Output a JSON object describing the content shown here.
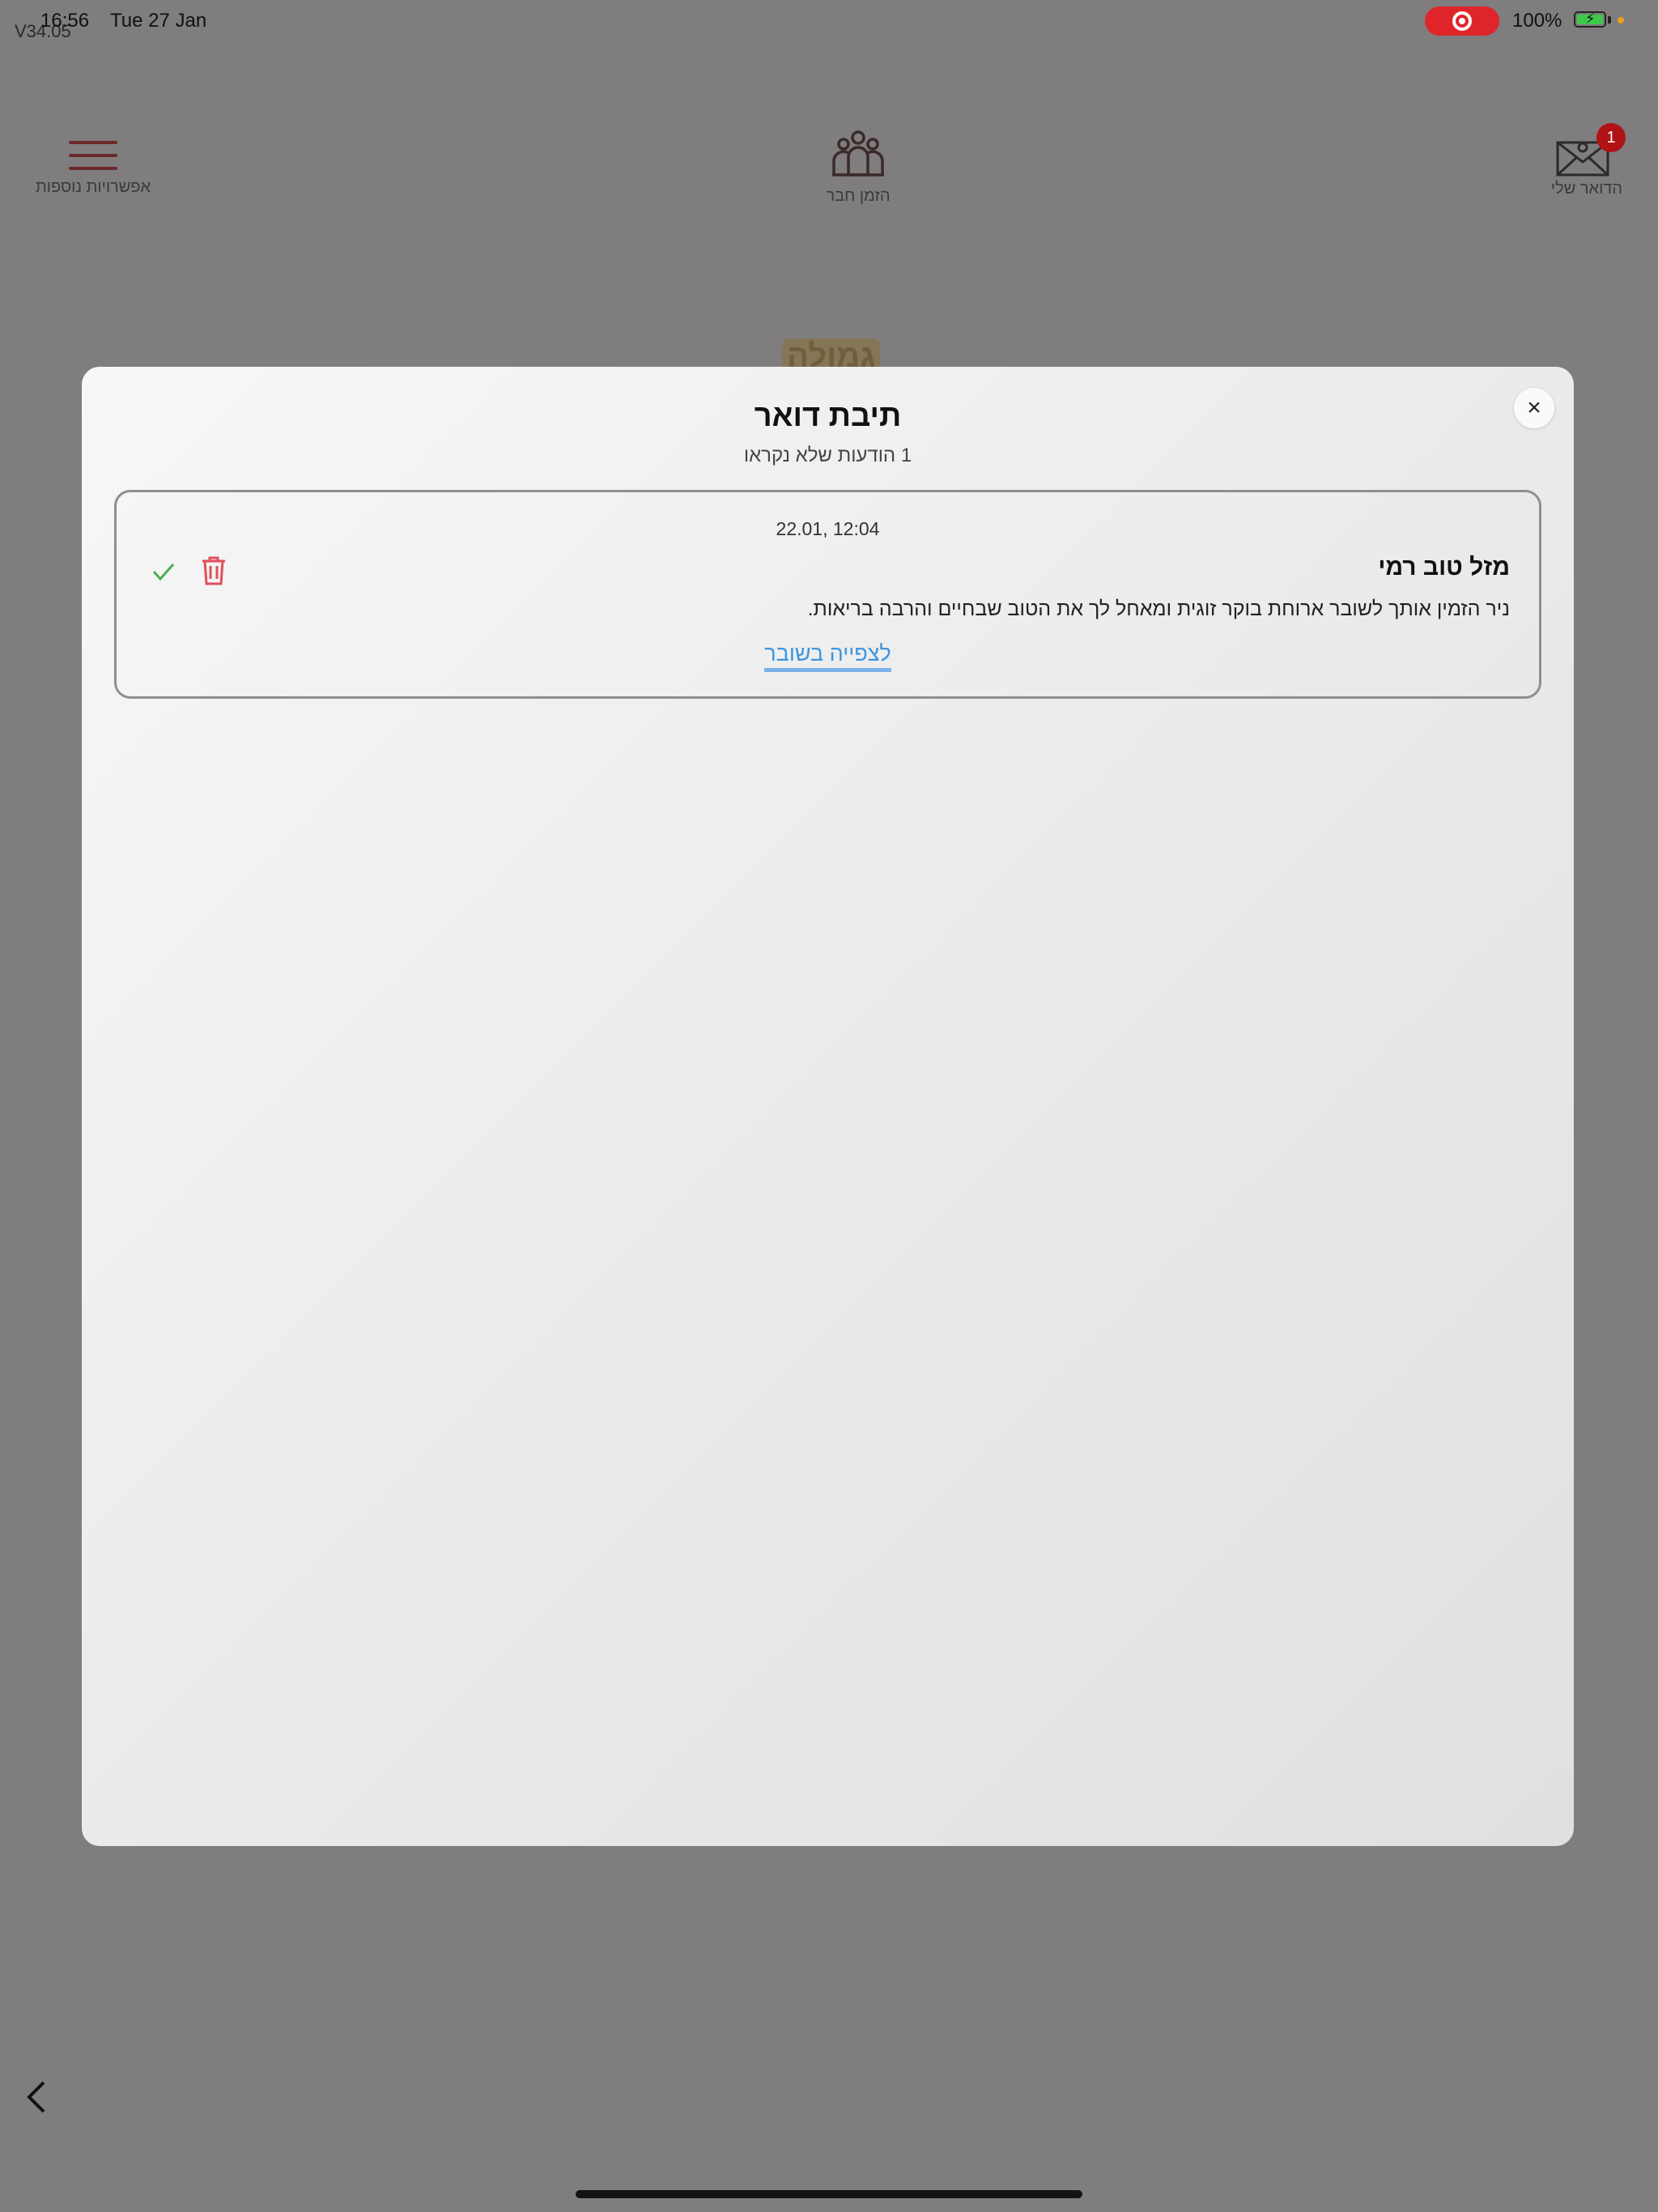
{
  "status_bar": {
    "version": "V34.05",
    "time": "16:56",
    "date": "Tue 27 Jan",
    "battery_pct": "100%",
    "colors": {
      "record": "#e0252a",
      "battery": "#3ec84a",
      "orange_dot": "#f0a11c"
    }
  },
  "nav": {
    "menu": {
      "label": "אפשרויות נוספות",
      "icon": "hamburger-icon"
    },
    "invite": {
      "label": "הזמן חבר",
      "icon": "people-icon"
    },
    "mail": {
      "label": "הדואר שלי",
      "icon": "envelope-icon",
      "badge": "1"
    }
  },
  "background": {
    "title": "גמולה"
  },
  "modal": {
    "title": "תיבת דואר",
    "subtitle": "1 הודעות שלא נקראו",
    "close": "×",
    "messages": [
      {
        "date": "22.01, 12:04",
        "sender": "מזל טוב רמי",
        "body": "ניר הזמין אותך לשובר  ארוחת בוקר זוגית ומאחל לך את הטוב שבחיים והרבה בריאות.",
        "link": "לצפייה בשובר",
        "actions": {
          "mark_read": "check-icon",
          "delete": "trash-icon"
        }
      }
    ]
  },
  "colors": {
    "overlay": "#7f7d7e",
    "badge": "#b01216",
    "link": "#3d95e0",
    "check": "#4caf50",
    "trash": "#e0505a"
  }
}
